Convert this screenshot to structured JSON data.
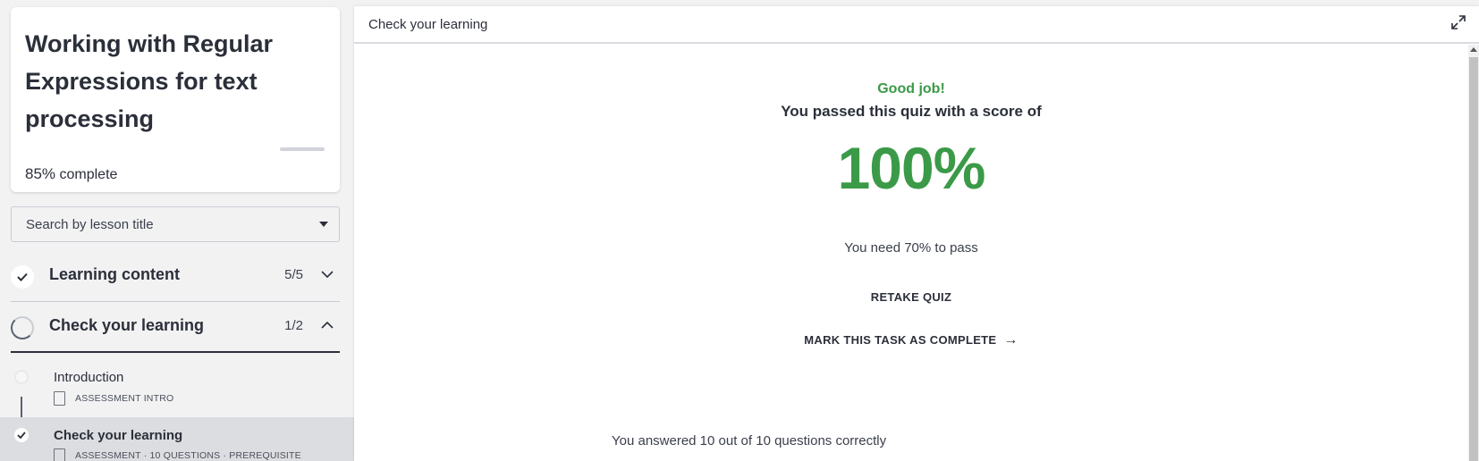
{
  "course": {
    "title": "Working with Regular Expressions for text processing",
    "progress_pct": "85%",
    "progress_label": "complete"
  },
  "search": {
    "placeholder": "Search by lesson title"
  },
  "sections": [
    {
      "title": "Learning content",
      "count": "5/5",
      "chevron": "chevron-down-icon"
    },
    {
      "title": "Check your learning",
      "count": "1/2",
      "chevron": "chevron-up-icon"
    }
  ],
  "lessons": [
    {
      "title": "Introduction",
      "meta": "ASSESSMENT INTRO"
    },
    {
      "title": "Check your learning",
      "meta": "ASSESSMENT · 10 QUESTIONS · PREREQUISITE"
    }
  ],
  "main": {
    "title": "Check your learning",
    "good_job": "Good job!",
    "passed": "You passed this quiz with a score of",
    "score": "100%",
    "need": "You need 70% to pass",
    "retake": "RETAKE QUIZ",
    "mark_complete": "MARK THIS TASK AS COMPLETE",
    "answered": "You answered 10 out of 10 questions correctly"
  },
  "colors": {
    "success": "#3b9a48",
    "text": "#2b2f3a",
    "selected_row": "#dcdde0"
  }
}
